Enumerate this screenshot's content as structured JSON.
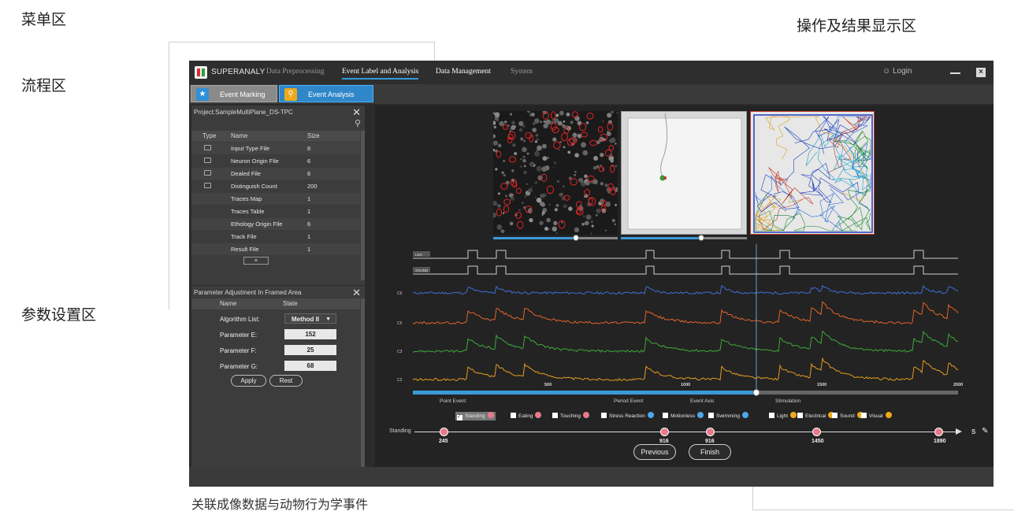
{
  "annotations": {
    "menu_area": "菜单区",
    "flow_area": "流程区",
    "param_area": "参数设置区",
    "result_area": "操作及结果显示区",
    "caption": "关联成像数据与动物行为学事件"
  },
  "app": {
    "name": "SUPERANALY",
    "menu": [
      "Data Preprocessing",
      "Event Label and Analysis",
      "Data Management",
      "System"
    ],
    "login": "Login",
    "flow_tabs": [
      "Event Marking",
      "Event Analysis"
    ]
  },
  "project_panel": {
    "title": "Project:SampleMultiPlane_DS-TPC",
    "columns": [
      "Type",
      "Name",
      "Size"
    ],
    "rows": [
      {
        "name": "Input Type File",
        "size": "6",
        "icon": true
      },
      {
        "name": "Neuron Origin File",
        "size": "6",
        "icon": true
      },
      {
        "name": "Dealed File",
        "size": "6",
        "icon": true
      },
      {
        "name": "Distinguish Count",
        "size": "200",
        "icon": true
      },
      {
        "name": "Traces Map",
        "size": "1",
        "icon": false
      },
      {
        "name": "Traces Table",
        "size": "1",
        "icon": false
      },
      {
        "name": "Ethology Origin File",
        "size": "6",
        "icon": false
      },
      {
        "name": "Track File",
        "size": "1",
        "icon": false
      },
      {
        "name": "Result File",
        "size": "1",
        "icon": false
      }
    ],
    "add_label": "+"
  },
  "param_panel": {
    "title": "Parameter Adjustment In Framed Area",
    "columns": [
      "Name",
      "State"
    ],
    "algorithm_label": "Algorithm List:",
    "algorithm_value": "Method II",
    "params": [
      {
        "label": "Parameter E:",
        "value": "152"
      },
      {
        "label": "Parameter F:",
        "value": "25"
      },
      {
        "label": "Parameter G:",
        "value": "68"
      }
    ],
    "apply": "Apply",
    "reset": "Rest"
  },
  "traces": {
    "stim_labels": [
      "LED",
      "SOUND"
    ],
    "channel_labels": [
      "C6",
      "C5",
      "C3",
      "C2"
    ],
    "channel_colors": [
      "#3d6fd6",
      "#e0632a",
      "#3fa83a",
      "#e39b1e"
    ],
    "x_ticks": [
      "500",
      "1000",
      "1500",
      "2000"
    ],
    "progress": 0.63,
    "legend": [
      "Point Event",
      "Period Event",
      "Event Axis",
      "Stimulation"
    ]
  },
  "categories": [
    {
      "label": "Standing",
      "checked": true,
      "color": "#e87a8a"
    },
    {
      "label": "Eating",
      "checked": false,
      "color": "#e87a8a"
    },
    {
      "label": "Touching",
      "checked": false,
      "color": "#e87a8a"
    },
    {
      "label": "Stress Reaction",
      "checked": false,
      "color": "#4ba7e8"
    },
    {
      "label": "Motionless",
      "checked": false,
      "color": "#4ba7e8"
    },
    {
      "label": "Swimming",
      "checked": false,
      "color": "#4ba7e8"
    },
    {
      "label": "Light",
      "checked": false,
      "color": "#f0a81c"
    },
    {
      "label": "Electrical",
      "checked": false,
      "color": "#f0a81c"
    },
    {
      "label": "Sound",
      "checked": false,
      "color": "#f0a81c"
    },
    {
      "label": "Visual",
      "checked": false,
      "color": "#f0a81c"
    }
  ],
  "event_axis": {
    "label": "Standing",
    "unit": "S",
    "markers": [
      "245",
      "916",
      "916",
      "1450",
      "1890"
    ]
  },
  "buttons": {
    "previous": "Previous",
    "finish": "Finish"
  }
}
